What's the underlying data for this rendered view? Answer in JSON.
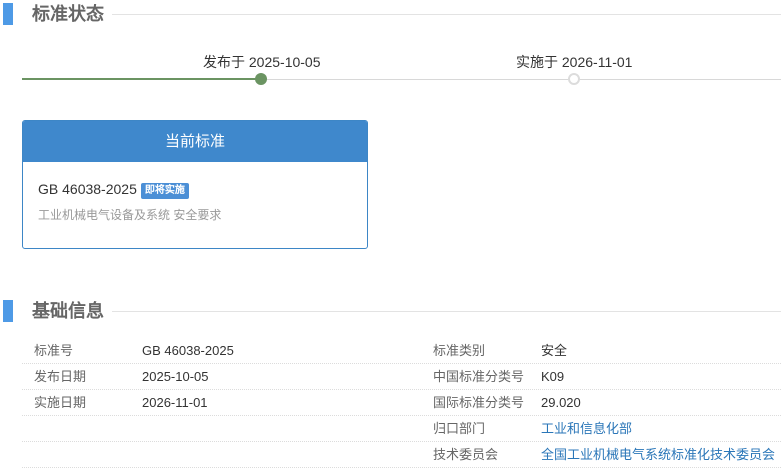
{
  "status_section": {
    "title": "标准状态"
  },
  "timeline": {
    "published_label": "发布于 2025-10-05",
    "implement_label": "实施于 2026-11-01"
  },
  "current_standard": {
    "header": "当前标准",
    "code": "GB 46038-2025",
    "badge": "即将实施",
    "name": "工业机械电气设备及系统 安全要求"
  },
  "basic_section": {
    "title": "基础信息"
  },
  "info_rows": [
    {
      "k1": "标准号",
      "v1": "GB 46038-2025",
      "k2": "标准类别",
      "v2": "安全"
    },
    {
      "k1": "发布日期",
      "v1": "2025-10-05",
      "k2": "中国标准分类号",
      "v2": "K09"
    },
    {
      "k1": "实施日期",
      "v1": "2026-11-01",
      "k2": "国际标准分类号",
      "v2": "29.020"
    },
    {
      "k1": "",
      "v1": "",
      "k2": "归口部门",
      "v2": "工业和信息化部"
    },
    {
      "k1": "",
      "v1": "",
      "k2": "技术委员会",
      "v2": "全国工业机械电气系统标准化技术委员会"
    }
  ],
  "colors": {
    "accent": "#4e9ae6",
    "card_header": "#3f88cc",
    "timeline_done": "#6b9462",
    "link": "#2a76b8"
  }
}
